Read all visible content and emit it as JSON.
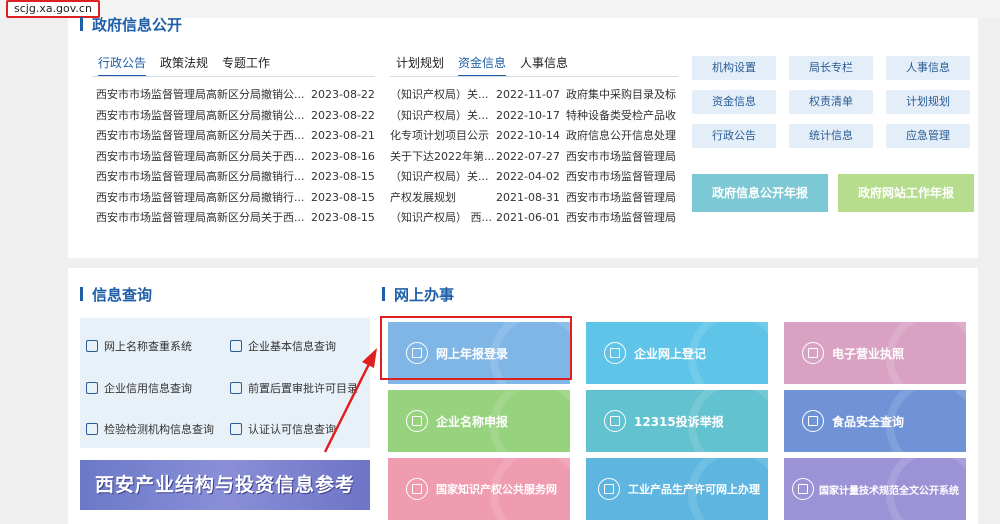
{
  "browser": {
    "url": "scjg.xa.gov.cn"
  },
  "gov_info": {
    "title": "政府信息公开",
    "tabs_left": [
      "行政公告",
      "政策法规",
      "专题工作"
    ],
    "tabs_right": [
      "计划规划",
      "资金信息",
      "人事信息"
    ],
    "list_left": [
      {
        "title": "西安市市场监督管理局高新区分局撤销公...",
        "date": "2023-08-22"
      },
      {
        "title": "西安市市场监督管理局高新区分局撤销公...",
        "date": "2023-08-22"
      },
      {
        "title": "西安市市场监督管理局高新区分局关于西...",
        "date": "2023-08-21"
      },
      {
        "title": "西安市市场监督管理局高新区分局关于西...",
        "date": "2023-08-16"
      },
      {
        "title": "西安市市场监督管理局高新区分局撤销行...",
        "date": "2023-08-15"
      },
      {
        "title": "西安市市场监督管理局高新区分局撤销行...",
        "date": "2023-08-15"
      },
      {
        "title": "西安市市场监督管理局高新区分局关于西...",
        "date": "2023-08-15"
      }
    ],
    "list_mid": [
      {
        "title": "（知识产权局）关...",
        "date": "2022-11-07"
      },
      {
        "title": "（知识产权局）关...",
        "date": "2022-10-17"
      },
      {
        "title": "化专项计划项目公示",
        "date": "2022-10-14"
      },
      {
        "title": "关于下达2022年第...",
        "date": "2022-07-27"
      },
      {
        "title": "（知识产权局）关...",
        "date": "2022-04-02"
      },
      {
        "title": "产权发展规划",
        "date": "2021-08-31"
      },
      {
        "title": "（知识产权局） 西...",
        "date": "2021-06-01"
      }
    ],
    "list_right": [
      "政府集中采购目录及标",
      "特种设备类受检产品收",
      "政府信息公开信息处理",
      "西安市市场监督管理局",
      "西安市市场监督管理局",
      "西安市市场监督管理局",
      "西安市市场监督管理局"
    ],
    "quick_links": [
      "机构设置",
      "局长专栏",
      "人事信息",
      "资金信息",
      "权责清单",
      "计划规划",
      "行政公告",
      "统计信息",
      "应急管理"
    ],
    "annual_report": "政府信息公开年报",
    "website_report": "政府网站工作年报"
  },
  "info_query": {
    "title": "信息查询",
    "items": [
      {
        "label": "网上名称查重系统",
        "icon": "document-icon"
      },
      {
        "label": "企业基本信息查询",
        "icon": "building-icon"
      },
      {
        "label": "企业信用信息查询",
        "icon": "document-icon"
      },
      {
        "label": "前置后置审批许可目录",
        "icon": "list-icon"
      },
      {
        "label": "检验检测机构信息查询",
        "icon": "document-icon"
      },
      {
        "label": "认证认可信息查询",
        "icon": "flask-icon"
      }
    ],
    "banner": "西安产业结构与投资信息参考"
  },
  "online_services": {
    "title": "网上办事",
    "tiles": [
      {
        "label": "网上年报登录",
        "color": "#7fb6e6",
        "icon": "chart-icon"
      },
      {
        "label": "企业网上登记",
        "color": "#5ec4e8",
        "icon": "form-icon"
      },
      {
        "label": "电子营业执照",
        "color": "#d9a2c2",
        "icon": "license-icon"
      },
      {
        "label": "企业名称申报",
        "color": "#97d27e",
        "icon": "edit-icon"
      },
      {
        "label": "12315投诉举报",
        "color": "#62c2d0",
        "icon": "phone-icon"
      },
      {
        "label": "食品安全查询",
        "color": "#6f93d6",
        "icon": "shield-icon"
      },
      {
        "label": "国家知识产权公共服务网",
        "color": "#ef9bb0",
        "icon": "cap-icon"
      },
      {
        "label": "工业产品生产许可网上办理",
        "color": "#5eb6e0",
        "icon": "target-icon"
      },
      {
        "label": "国家计量技术规范全文公开系统",
        "color": "#9b93d6",
        "icon": "book-icon"
      }
    ]
  },
  "colors": {
    "accent": "#1f5fa8",
    "highlight": "#e02020"
  }
}
